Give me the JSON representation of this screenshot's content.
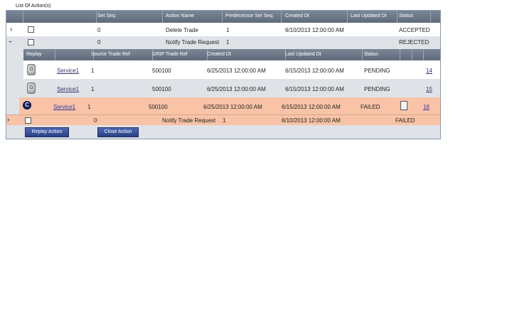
{
  "title": "List Of Action(s)",
  "headers": [
    "Set Seq",
    "Action Name",
    "Predecessor Set Seq.",
    "Created Dt",
    "Last Updated Dt",
    "Status"
  ],
  "rows": [
    {
      "set_seq": "0",
      "action_name": "Delete Trade",
      "pred": "1",
      "created": "6/10/2013 12:00:00 AM",
      "updated": "",
      "status": "ACCEPTED"
    },
    {
      "set_seq": "0",
      "action_name": "Notify Trade Request",
      "pred": "1",
      "created": "",
      "updated": "",
      "status": "REJECTED"
    }
  ],
  "sub_headers": [
    "Replay",
    "Source Trade Ref",
    "GRIP Trade Ref",
    "Created Dt",
    "Last Updated Dt",
    "Status"
  ],
  "sub_rows": [
    {
      "service": "Service1",
      "source": "1",
      "grip": "500100",
      "created": "6/25/2013 12:00:00 AM",
      "updated": "6/15/2013 12:00:00 AM",
      "status": "PENDING",
      "num": "14"
    },
    {
      "service": "Service1",
      "source": "1",
      "grip": "500100",
      "created": "6/25/2013 12:00:00 AM",
      "updated": "6/15/2013 12:00:00 AM",
      "status": "PENDING",
      "num": "15"
    },
    {
      "service": "Service1",
      "source": "1",
      "grip": "500100",
      "created": "6/25/2013 12:00:00 AM",
      "updated": "6/15/2013 12:00:00 AM",
      "status": "FAILED",
      "num": "16"
    }
  ],
  "last_row": {
    "set_seq": "0",
    "action_name": "Notify Trade Request",
    "pred": "1",
    "created": "6/10/2013 12:00:00 AM",
    "status": "FAILED"
  },
  "buttons": {
    "replay": "Replay Action",
    "close": "Close Action"
  },
  "colors": {
    "highlight": "#f8c3a6",
    "header": "#6b7687",
    "selected_row": "#dfe3e8"
  }
}
